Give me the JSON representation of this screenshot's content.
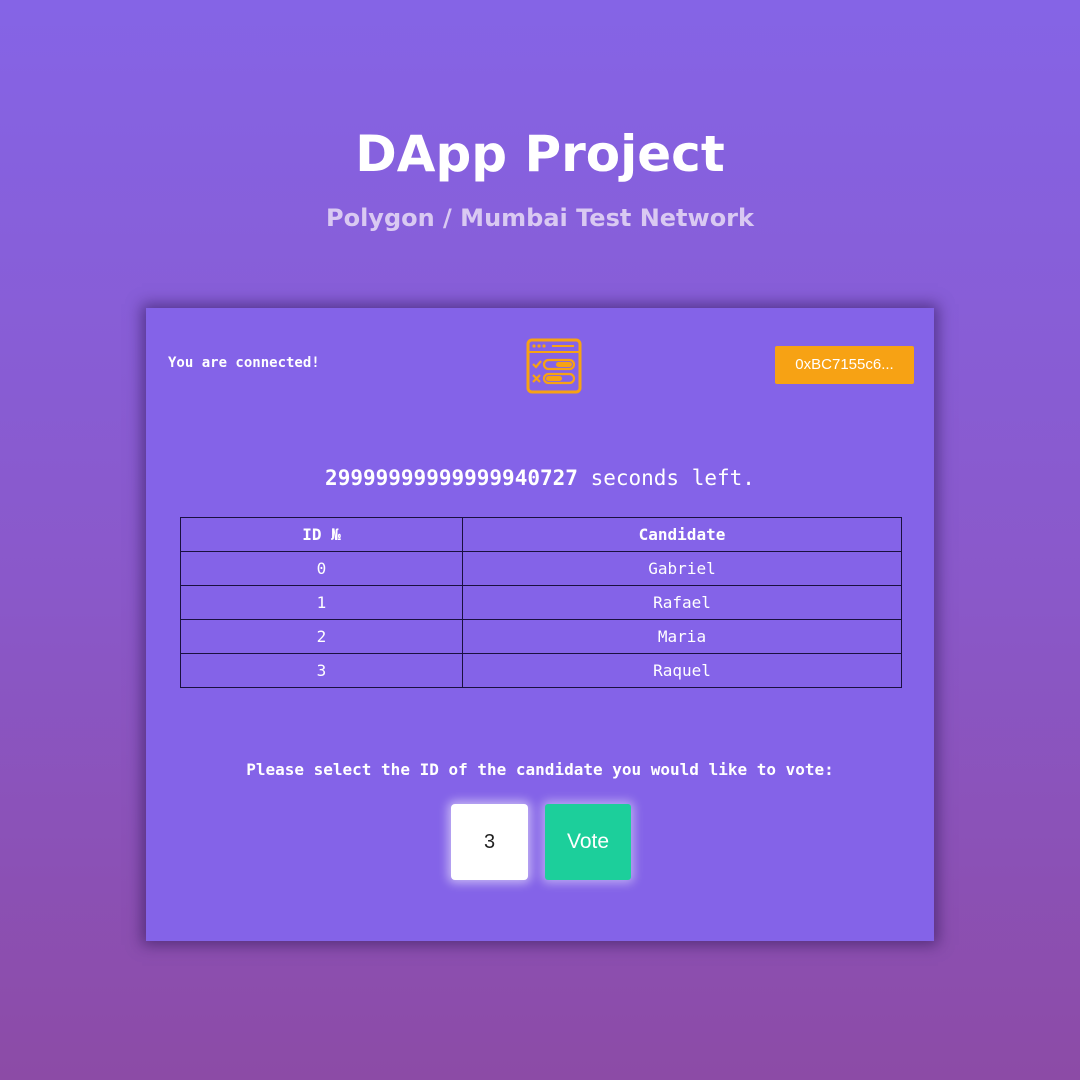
{
  "header": {
    "title": "DApp Project",
    "subtitle": "Polygon / Mumbai Test Network"
  },
  "card": {
    "status_text": "You are connected!",
    "logo_icon": "voting-checklist-icon",
    "wallet_address": "0xBC7155c6...",
    "countdown": {
      "value": "29999999999999940727",
      "suffix": "seconds left."
    },
    "table": {
      "headers": [
        "ID №",
        "Candidate"
      ],
      "rows": [
        {
          "id": "0",
          "name": "Gabriel"
        },
        {
          "id": "1",
          "name": "Rafael"
        },
        {
          "id": "2",
          "name": "Maria"
        },
        {
          "id": "3",
          "name": "Raquel"
        }
      ]
    },
    "vote_prompt": "Please select the ID of the candidate you would like to vote:",
    "id_input_value": "3",
    "vote_label": "Vote"
  },
  "colors": {
    "accent": "#f7a214",
    "vote": "#1ccf9b",
    "card_bg": "#8463e8"
  }
}
